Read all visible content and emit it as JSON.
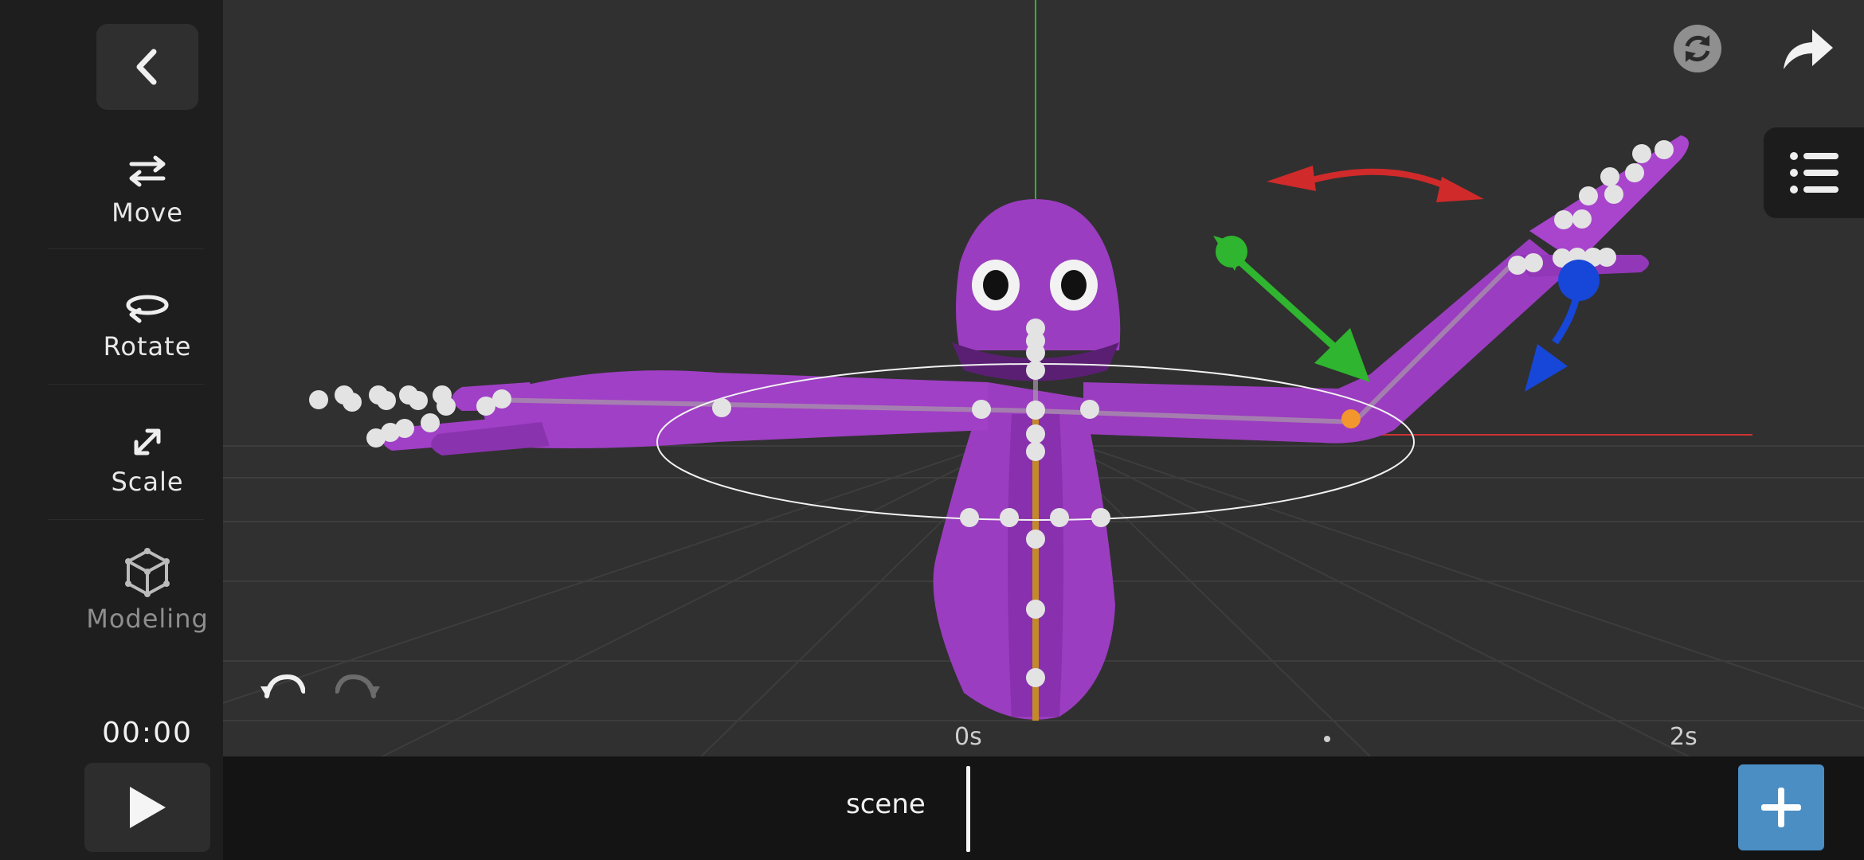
{
  "sidebar": {
    "tools": [
      {
        "label": "Move",
        "icon": "move-arrows-icon",
        "active": true
      },
      {
        "label": "Rotate",
        "icon": "rotate-icon",
        "active": true
      },
      {
        "label": "Scale",
        "icon": "scale-icon",
        "active": true
      },
      {
        "label": "Modeling",
        "icon": "cube-icon",
        "active": false
      }
    ],
    "time": "00:00"
  },
  "viewport": {
    "character_color": "#9b3dc0",
    "gizmo_colors": {
      "x": "#d02a2a",
      "y": "#2fb52f",
      "z": "#1747d8"
    }
  },
  "timeline": {
    "ruler": [
      "0s",
      "2s"
    ],
    "track_label": "scene",
    "add_color": "#4a8ec4"
  }
}
